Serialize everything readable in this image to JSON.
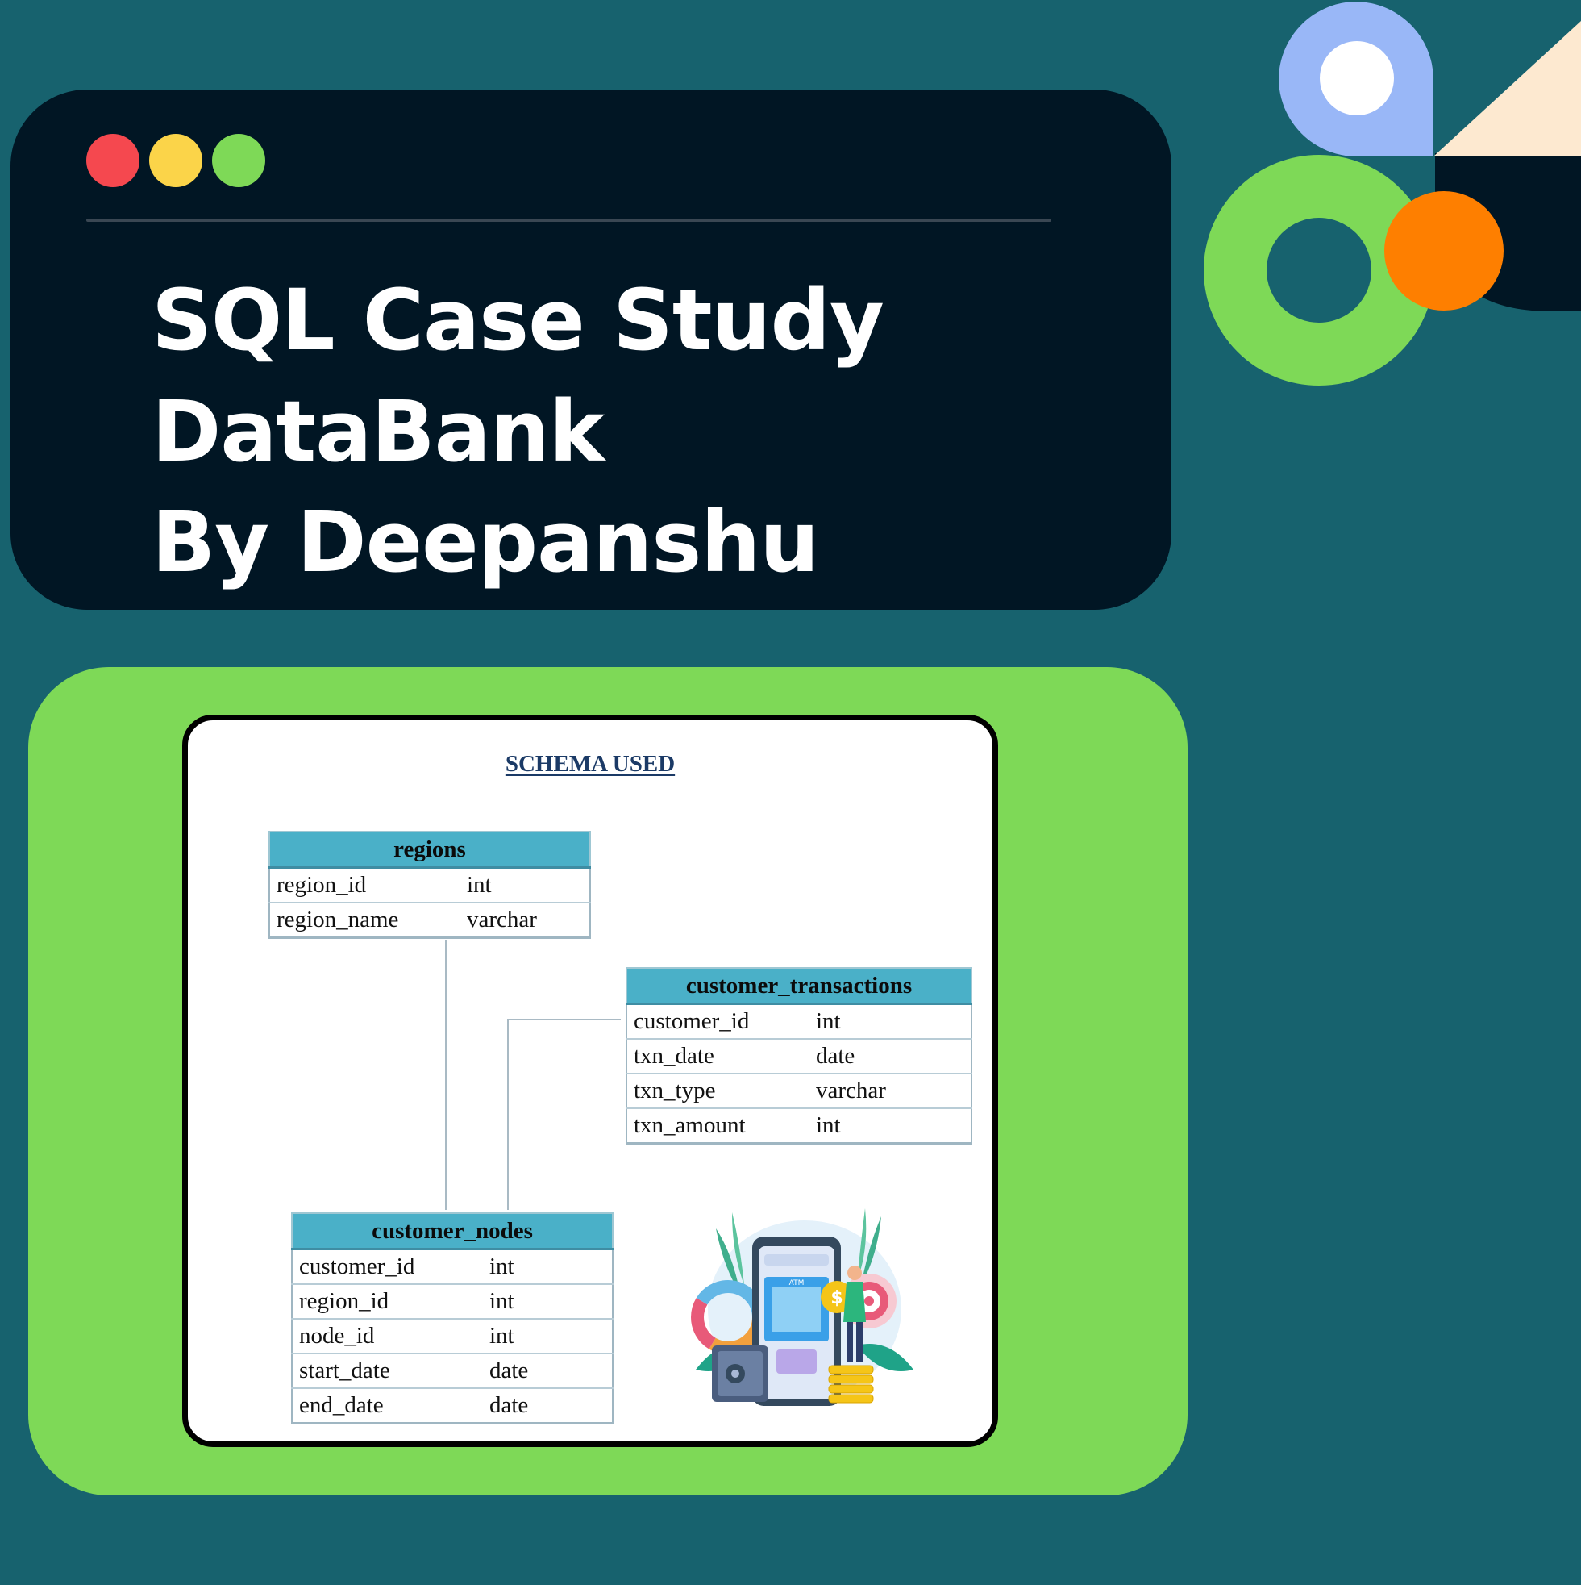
{
  "title": {
    "line1": "SQL Case Study",
    "line2": "DataBank",
    "line3": "By Deepanshu"
  },
  "window_dots": [
    "#f5484f",
    "#fbd449",
    "#7ed957"
  ],
  "schema": {
    "title": "SCHEMA USED",
    "tables": {
      "regions": {
        "name": "regions",
        "columns": [
          {
            "name": "region_id",
            "type": "int"
          },
          {
            "name": "region_name",
            "type": "varchar"
          }
        ]
      },
      "customer_transactions": {
        "name": "customer_transactions",
        "columns": [
          {
            "name": "customer_id",
            "type": "int"
          },
          {
            "name": "txn_date",
            "type": "date"
          },
          {
            "name": "txn_type",
            "type": "varchar"
          },
          {
            "name": "txn_amount",
            "type": "int"
          }
        ]
      },
      "customer_nodes": {
        "name": "customer_nodes",
        "columns": [
          {
            "name": "customer_id",
            "type": "int"
          },
          {
            "name": "region_id",
            "type": "int"
          },
          {
            "name": "node_id",
            "type": "int"
          },
          {
            "name": "start_date",
            "type": "date"
          },
          {
            "name": "end_date",
            "type": "date"
          }
        ]
      }
    },
    "relations": [
      {
        "from": "regions.region_id",
        "to": "customer_nodes.region_id"
      },
      {
        "from": "customer_transactions.customer_id",
        "to": "customer_nodes.customer_id"
      }
    ]
  },
  "illustration": {
    "atm_label": "ATM",
    "currency_symbol": "$"
  },
  "colors": {
    "background": "#17626e",
    "title_card": "#011624",
    "green_panel": "#7ed957",
    "table_header": "#4ab0c8",
    "deco_blue": "#99b7f7",
    "deco_orange": "#fe7f00",
    "deco_cream": "#fde9d0"
  }
}
